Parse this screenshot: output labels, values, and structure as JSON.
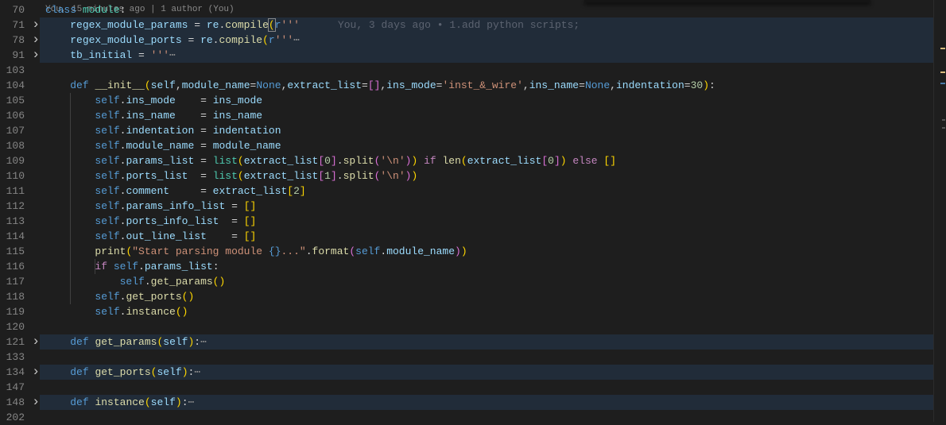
{
  "editor": {
    "codelens": "You, 15 minutes ago | 1 author (You)",
    "blame": "You, 3 days ago • 1.add python scripts;",
    "cursor_line": "71",
    "lines": [
      {
        "num": "70",
        "tokens": [
          [
            "k",
            "class "
          ],
          [
            "t",
            "module"
          ],
          [
            "p",
            ":"
          ]
        ]
      },
      {
        "num": "71",
        "folded": true,
        "blame": true,
        "tokens": [
          [
            "p",
            "    "
          ],
          [
            "v",
            "regex_module_params"
          ],
          [
            "p",
            " = "
          ],
          [
            "v",
            "re"
          ],
          [
            "p",
            "."
          ],
          [
            "f",
            "compile"
          ],
          [
            "b1 cur",
            "("
          ],
          [
            "k",
            "r"
          ],
          [
            "s",
            "'''"
          ]
        ]
      },
      {
        "num": "78",
        "folded": true,
        "tokens": [
          [
            "p",
            "    "
          ],
          [
            "v",
            "regex_module_ports"
          ],
          [
            "p",
            " = "
          ],
          [
            "v",
            "re"
          ],
          [
            "p",
            "."
          ],
          [
            "f",
            "compile"
          ],
          [
            "b1",
            "("
          ],
          [
            "k",
            "r"
          ],
          [
            "s",
            "'''"
          ],
          [
            "g",
            "⋯"
          ]
        ]
      },
      {
        "num": "91",
        "folded": true,
        "tokens": [
          [
            "p",
            "    "
          ],
          [
            "v",
            "tb_initial"
          ],
          [
            "p",
            " = "
          ],
          [
            "s",
            "'''"
          ],
          [
            "g",
            "⋯"
          ]
        ]
      },
      {
        "num": "103",
        "tokens": []
      },
      {
        "num": "104",
        "tokens": [
          [
            "p",
            "    "
          ],
          [
            "k",
            "def "
          ],
          [
            "f",
            "__init__"
          ],
          [
            "b1",
            "("
          ],
          [
            "v",
            "self"
          ],
          [
            "p",
            ","
          ],
          [
            "v",
            "module_name"
          ],
          [
            "p",
            "="
          ],
          [
            "k",
            "None"
          ],
          [
            "p",
            ","
          ],
          [
            "v",
            "extract_list"
          ],
          [
            "p",
            "="
          ],
          [
            "b2",
            "[]"
          ],
          [
            "p",
            ","
          ],
          [
            "v",
            "ins_mode"
          ],
          [
            "p",
            "="
          ],
          [
            "s",
            "'inst_&_wire'"
          ],
          [
            "p",
            ","
          ],
          [
            "v",
            "ins_name"
          ],
          [
            "p",
            "="
          ],
          [
            "k",
            "None"
          ],
          [
            "p",
            ","
          ],
          [
            "v",
            "indentation"
          ],
          [
            "p",
            "="
          ],
          [
            "n",
            "30"
          ],
          [
            "b1",
            ")"
          ],
          [
            "p",
            ":"
          ]
        ]
      },
      {
        "num": "105",
        "tokens": [
          [
            "p",
            "        "
          ],
          [
            "k",
            "self"
          ],
          [
            "p",
            "."
          ],
          [
            "v",
            "ins_mode"
          ],
          [
            "p",
            "    = "
          ],
          [
            "v",
            "ins_mode"
          ]
        ]
      },
      {
        "num": "106",
        "tokens": [
          [
            "p",
            "        "
          ],
          [
            "k",
            "self"
          ],
          [
            "p",
            "."
          ],
          [
            "v",
            "ins_name"
          ],
          [
            "p",
            "    = "
          ],
          [
            "v",
            "ins_name"
          ]
        ]
      },
      {
        "num": "107",
        "tokens": [
          [
            "p",
            "        "
          ],
          [
            "k",
            "self"
          ],
          [
            "p",
            "."
          ],
          [
            "v",
            "indentation"
          ],
          [
            "p",
            " = "
          ],
          [
            "v",
            "indentation"
          ]
        ]
      },
      {
        "num": "108",
        "tokens": [
          [
            "p",
            "        "
          ],
          [
            "k",
            "self"
          ],
          [
            "p",
            "."
          ],
          [
            "v",
            "module_name"
          ],
          [
            "p",
            " = "
          ],
          [
            "v",
            "module_name"
          ]
        ]
      },
      {
        "num": "109",
        "tokens": [
          [
            "p",
            "        "
          ],
          [
            "k",
            "self"
          ],
          [
            "p",
            "."
          ],
          [
            "v",
            "params_list"
          ],
          [
            "p",
            " = "
          ],
          [
            "t",
            "list"
          ],
          [
            "b1",
            "("
          ],
          [
            "v",
            "extract_list"
          ],
          [
            "b2",
            "["
          ],
          [
            "n",
            "0"
          ],
          [
            "b2",
            "]"
          ],
          [
            "p",
            "."
          ],
          [
            "f",
            "split"
          ],
          [
            "b2",
            "("
          ],
          [
            "s",
            "'\\n'"
          ],
          [
            "b2",
            ")"
          ],
          [
            "b1",
            ")"
          ],
          [
            "c",
            " if "
          ],
          [
            "f",
            "len"
          ],
          [
            "b1",
            "("
          ],
          [
            "v",
            "extract_list"
          ],
          [
            "b2",
            "["
          ],
          [
            "n",
            "0"
          ],
          [
            "b2",
            "]"
          ],
          [
            "b1",
            ")"
          ],
          [
            "c",
            " else "
          ],
          [
            "b1",
            "[]"
          ]
        ]
      },
      {
        "num": "110",
        "tokens": [
          [
            "p",
            "        "
          ],
          [
            "k",
            "self"
          ],
          [
            "p",
            "."
          ],
          [
            "v",
            "ports_list"
          ],
          [
            "p",
            "  = "
          ],
          [
            "t",
            "list"
          ],
          [
            "b1",
            "("
          ],
          [
            "v",
            "extract_list"
          ],
          [
            "b2",
            "["
          ],
          [
            "n",
            "1"
          ],
          [
            "b2",
            "]"
          ],
          [
            "p",
            "."
          ],
          [
            "f",
            "split"
          ],
          [
            "b2",
            "("
          ],
          [
            "s",
            "'\\n'"
          ],
          [
            "b2",
            ")"
          ],
          [
            "b1",
            ")"
          ]
        ]
      },
      {
        "num": "111",
        "tokens": [
          [
            "p",
            "        "
          ],
          [
            "k",
            "self"
          ],
          [
            "p",
            "."
          ],
          [
            "v",
            "comment"
          ],
          [
            "p",
            "     = "
          ],
          [
            "v",
            "extract_list"
          ],
          [
            "b1",
            "["
          ],
          [
            "n",
            "2"
          ],
          [
            "b1",
            "]"
          ]
        ]
      },
      {
        "num": "112",
        "tokens": [
          [
            "p",
            "        "
          ],
          [
            "k",
            "self"
          ],
          [
            "p",
            "."
          ],
          [
            "v",
            "params_info_list"
          ],
          [
            "p",
            " = "
          ],
          [
            "b1",
            "[]"
          ]
        ]
      },
      {
        "num": "113",
        "tokens": [
          [
            "p",
            "        "
          ],
          [
            "k",
            "self"
          ],
          [
            "p",
            "."
          ],
          [
            "v",
            "ports_info_list"
          ],
          [
            "p",
            "  = "
          ],
          [
            "b1",
            "[]"
          ]
        ]
      },
      {
        "num": "114",
        "tokens": [
          [
            "p",
            "        "
          ],
          [
            "k",
            "self"
          ],
          [
            "p",
            "."
          ],
          [
            "v",
            "out_line_list"
          ],
          [
            "p",
            "    = "
          ],
          [
            "b1",
            "[]"
          ]
        ]
      },
      {
        "num": "115",
        "tokens": [
          [
            "p",
            "        "
          ],
          [
            "f",
            "print"
          ],
          [
            "b1",
            "("
          ],
          [
            "s",
            "\"Start parsing module "
          ],
          [
            "k",
            "{}"
          ],
          [
            "s",
            "...\""
          ],
          [
            "p",
            "."
          ],
          [
            "f",
            "format"
          ],
          [
            "b2",
            "("
          ],
          [
            "k",
            "self"
          ],
          [
            "p",
            "."
          ],
          [
            "v",
            "module_name"
          ],
          [
            "b2",
            ")"
          ],
          [
            "b1",
            ")"
          ]
        ]
      },
      {
        "num": "116",
        "tokens": [
          [
            "p",
            "        "
          ],
          [
            "c",
            "if "
          ],
          [
            "k",
            "self"
          ],
          [
            "p",
            "."
          ],
          [
            "v",
            "params_list"
          ],
          [
            "p",
            ":"
          ]
        ]
      },
      {
        "num": "117",
        "tokens": [
          [
            "p",
            "            "
          ],
          [
            "k",
            "self"
          ],
          [
            "p",
            "."
          ],
          [
            "f",
            "get_params"
          ],
          [
            "b1",
            "()"
          ]
        ]
      },
      {
        "num": "118",
        "tokens": [
          [
            "p",
            "        "
          ],
          [
            "k",
            "self"
          ],
          [
            "p",
            "."
          ],
          [
            "f",
            "get_ports"
          ],
          [
            "b1",
            "()"
          ]
        ]
      },
      {
        "num": "119",
        "tokens": [
          [
            "p",
            "        "
          ],
          [
            "k",
            "self"
          ],
          [
            "p",
            "."
          ],
          [
            "f",
            "instance"
          ],
          [
            "b1",
            "()"
          ]
        ]
      },
      {
        "num": "120",
        "tokens": []
      },
      {
        "num": "121",
        "folded": true,
        "tokens": [
          [
            "p",
            "    "
          ],
          [
            "k",
            "def "
          ],
          [
            "f",
            "get_params"
          ],
          [
            "b1",
            "("
          ],
          [
            "v",
            "self"
          ],
          [
            "b1",
            ")"
          ],
          [
            "p",
            ":"
          ],
          [
            "g",
            "⋯"
          ]
        ]
      },
      {
        "num": "133",
        "tokens": []
      },
      {
        "num": "134",
        "folded": true,
        "tokens": [
          [
            "p",
            "    "
          ],
          [
            "k",
            "def "
          ],
          [
            "f",
            "get_ports"
          ],
          [
            "b1",
            "("
          ],
          [
            "v",
            "self"
          ],
          [
            "b1",
            ")"
          ],
          [
            "p",
            ":"
          ],
          [
            "g",
            "⋯"
          ]
        ]
      },
      {
        "num": "147",
        "tokens": []
      },
      {
        "num": "148",
        "folded": true,
        "tokens": [
          [
            "p",
            "    "
          ],
          [
            "k",
            "def "
          ],
          [
            "f",
            "instance"
          ],
          [
            "b1",
            "("
          ],
          [
            "v",
            "self"
          ],
          [
            "b1",
            ")"
          ],
          [
            "p",
            ":"
          ],
          [
            "g",
            "⋯"
          ]
        ]
      },
      {
        "num": "202",
        "tokens": []
      }
    ]
  },
  "colors": {
    "background": "#1e1e1e",
    "folded_highlight": "#212c39",
    "line_number": "#858585"
  }
}
